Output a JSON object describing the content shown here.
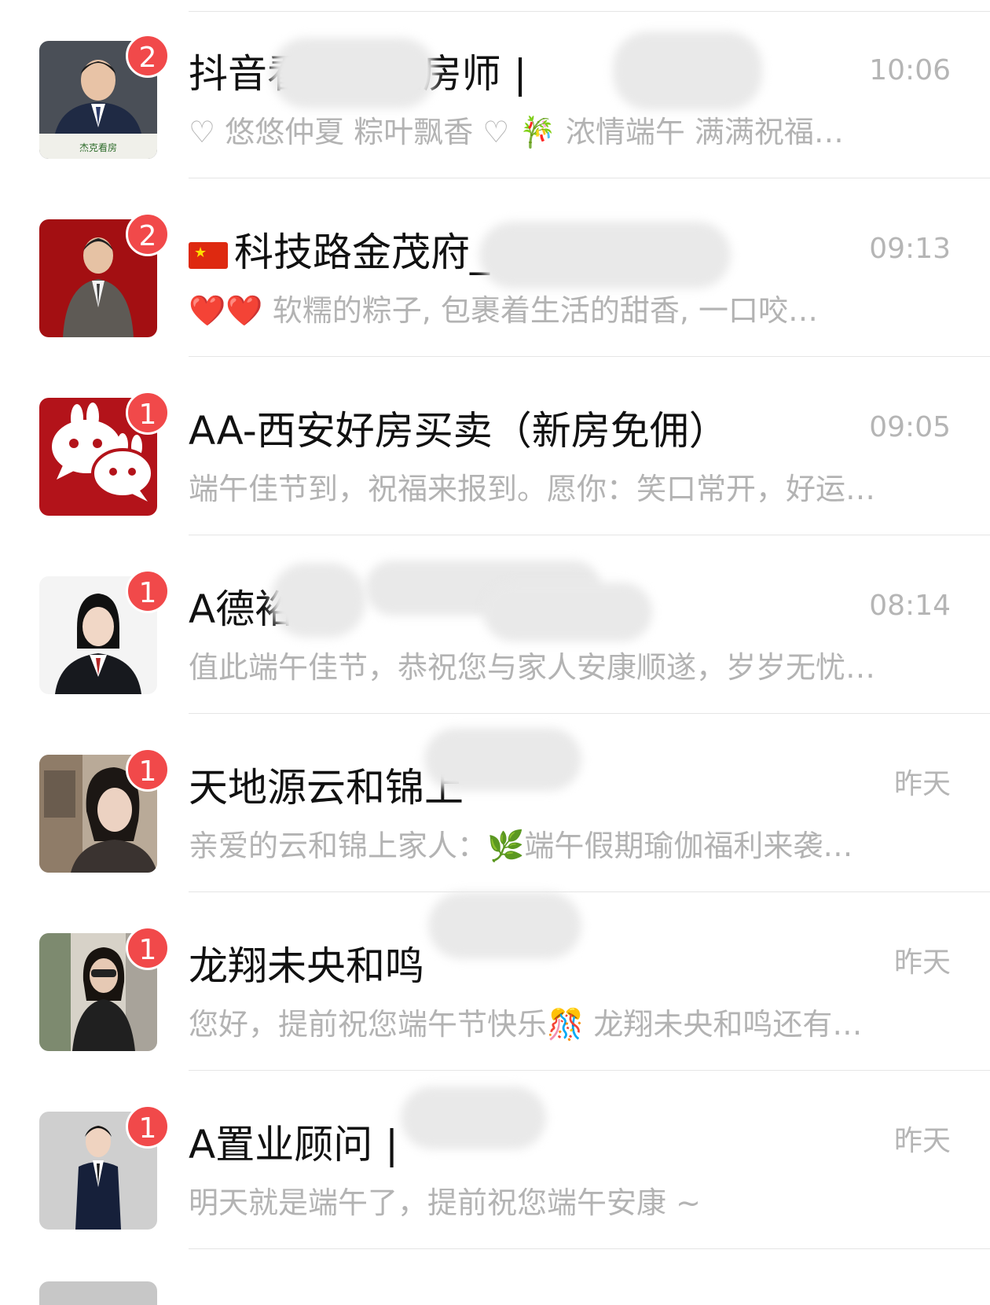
{
  "chats": [
    {
      "title": "抖音看房 · 选房师 | ",
      "time": "10:06",
      "badge": "2",
      "preview": "♡ 悠悠仲夏 粽叶飘香 ♡ 🎋 浓情端午 满满祝福…",
      "avatar_caption": "杰克看房",
      "avatar_icon": "man-in-suit-portrait"
    },
    {
      "flag": "🇨🇳",
      "title": "科技路金茂府_",
      "time": "09:13",
      "badge": "2",
      "preview": "❤️❤️ 软糯的粽子, 包裹着生活的甜香, 一口咬…",
      "avatar_icon": "man-on-red-background"
    },
    {
      "title": "AA-西安好房买卖（新房免佣）",
      "time": "09:05",
      "badge": "1",
      "preview": "端午佳节到，祝福来报到。愿你：笑口常开，好运…",
      "avatar_icon": "wechat-bunny-logo"
    },
    {
      "title": "A德裕",
      "time": "08:14",
      "badge": "1",
      "preview": "值此端午佳节，恭祝您与家人安康顺遂，岁岁无忧…",
      "avatar_icon": "woman-in-suit-portrait"
    },
    {
      "title": "天地源云和锦上",
      "time": "昨天",
      "badge": "1",
      "preview": "亲爱的云和锦上家人：🌿端午假期瑜伽福利来袭…",
      "avatar_icon": "woman-selfie-portrait"
    },
    {
      "title": "龙翔未央和鸣",
      "time": "昨天",
      "badge": "1",
      "preview": "您好，提前祝您端午节快乐🎊 龙翔未央和鸣还有…",
      "avatar_icon": "woman-mirror-selfie"
    },
    {
      "title": "A置业顾问 |",
      "time": "昨天",
      "badge": "1",
      "preview": "明天就是端午了，提前祝您端午安康 ~",
      "avatar_icon": "man-in-suit-full-body"
    }
  ]
}
